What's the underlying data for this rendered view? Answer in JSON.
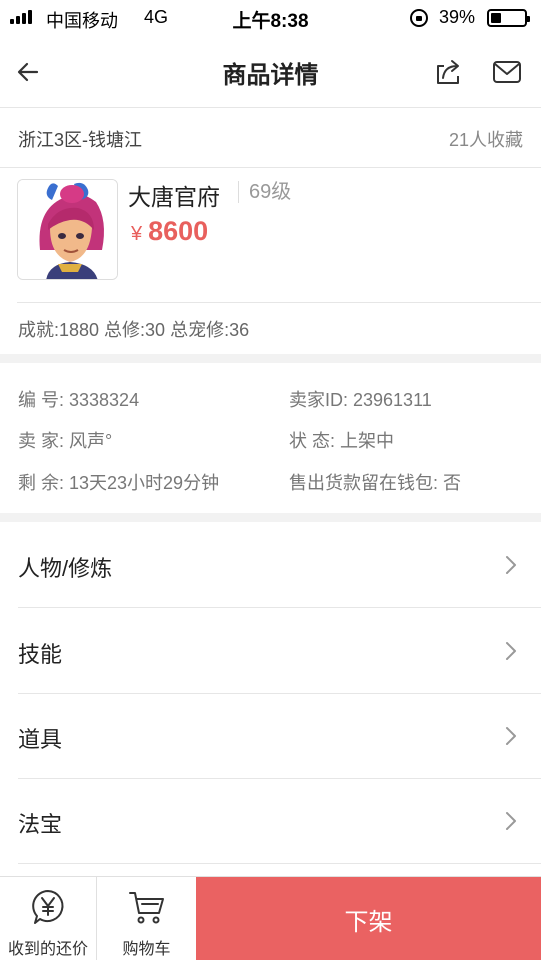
{
  "status_bar": {
    "carrier": "中国移动",
    "network": "4G",
    "time": "上午8:38",
    "battery": "39%",
    "battery_level": 0.39
  },
  "nav": {
    "title": "商品详情"
  },
  "location": {
    "server": "浙江3区-钱塘江",
    "favorites": "21人收藏"
  },
  "product": {
    "name": "大唐官府",
    "level": "69级",
    "currency": "¥",
    "price": "8600",
    "stats": "成就:1880 总修:30 总宠修:36"
  },
  "info": {
    "id": "编 号: 3338324",
    "seller_id": "卖家ID: 23961311",
    "seller": "卖 家: 风声°",
    "status": "状 态: 上架中",
    "remaining": "剩 余: 13天23小时29分钟",
    "wallet": "售出货款留在钱包: 否"
  },
  "sections": [
    {
      "label": "人物/修炼"
    },
    {
      "label": "技能"
    },
    {
      "label": "道具"
    },
    {
      "label": "法宝"
    }
  ],
  "bottom": {
    "offers_label": "收到的还价",
    "cart_label": "购物车",
    "delist_label": "下架"
  },
  "colors": {
    "accent": "#ea6262",
    "price": "#e8605d"
  },
  "icons": [
    "back-arrow-icon",
    "share-icon",
    "mail-icon",
    "chevron-right-icon",
    "yen-bubble-icon",
    "cart-icon"
  ]
}
